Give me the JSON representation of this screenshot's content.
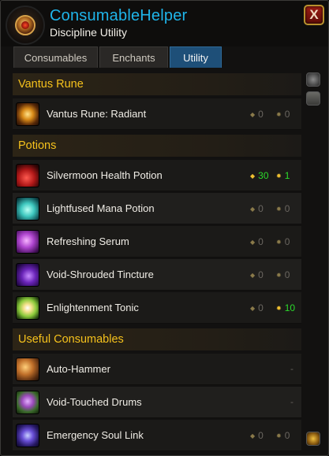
{
  "header": {
    "title": "ConsumableHelper",
    "subtitle": "Discipline Utility",
    "close_label": "X"
  },
  "tabs": [
    {
      "label": "Consumables",
      "active": false
    },
    {
      "label": "Enchants",
      "active": false
    },
    {
      "label": "Utility",
      "active": true
    }
  ],
  "sections": [
    {
      "title": "Vantus Rune",
      "items": [
        {
          "name": "Vantus Rune: Radiant",
          "icon": "vantus-rune-icon",
          "count_a": "0",
          "count_b": "0"
        }
      ]
    },
    {
      "title": "Potions",
      "items": [
        {
          "name": "Silvermoon Health Potion",
          "icon": "health-potion-icon",
          "count_a": "30",
          "count_b": "1"
        },
        {
          "name": "Lightfused Mana Potion",
          "icon": "mana-potion-icon",
          "count_a": "0",
          "count_b": "0"
        },
        {
          "name": "Refreshing Serum",
          "icon": "serum-icon",
          "count_a": "0",
          "count_b": "0"
        },
        {
          "name": "Void-Shrouded Tincture",
          "icon": "tincture-icon",
          "count_a": "0",
          "count_b": "0"
        },
        {
          "name": "Enlightenment Tonic",
          "icon": "tonic-icon",
          "count_a": "0",
          "count_b": "10"
        }
      ]
    },
    {
      "title": "Useful Consumables",
      "items": [
        {
          "name": "Auto-Hammer",
          "icon": "hammer-icon",
          "count": "-"
        },
        {
          "name": "Void-Touched Drums",
          "icon": "drums-icon",
          "count": "-"
        },
        {
          "name": "Emergency Soul Link",
          "icon": "soul-link-icon",
          "count_a": "0",
          "count_b": "0"
        }
      ]
    }
  ],
  "colors": {
    "title": "#1fb5ea",
    "section_header": "#f6c21c",
    "positive_count": "#2bd92b",
    "active_tab": "#1e4f78"
  }
}
